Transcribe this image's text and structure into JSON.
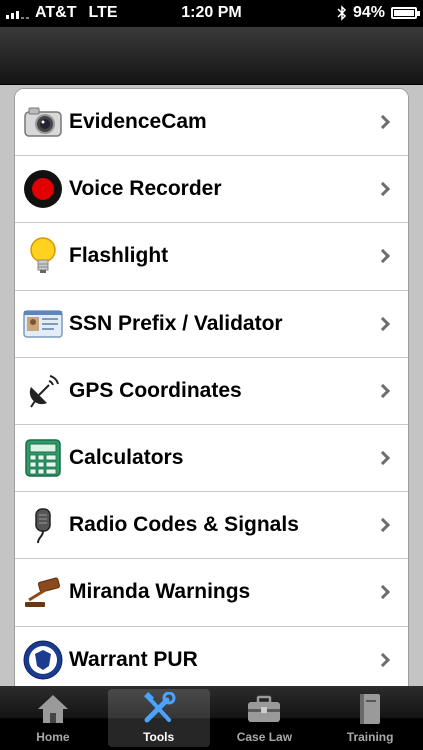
{
  "status_bar": {
    "carrier": "AT&T",
    "network": "LTE",
    "time": "1:20 PM",
    "battery_percent_text": "94%",
    "battery_level": 0.94,
    "bluetooth_icon": "bluetooth-icon"
  },
  "nav_bar": {
    "title": ""
  },
  "tools": {
    "items": [
      {
        "label": "EvidenceCam",
        "icon": "camera-icon"
      },
      {
        "label": "Voice Recorder",
        "icon": "record-icon"
      },
      {
        "label": "Flashlight",
        "icon": "lightbulb-icon"
      },
      {
        "label": "SSN Prefix / Validator",
        "icon": "id-card-icon"
      },
      {
        "label": "GPS Coordinates",
        "icon": "satellite-dish-icon"
      },
      {
        "label": "Calculators",
        "icon": "calculator-icon"
      },
      {
        "label": "Radio Codes & Signals",
        "icon": "radio-mic-icon"
      },
      {
        "label": "Miranda Warnings",
        "icon": "gavel-icon"
      },
      {
        "label": "Warrant PUR",
        "icon": "police-badge-icon"
      }
    ]
  },
  "tab_bar": {
    "selected": "Tools",
    "tabs": [
      {
        "label": "Home",
        "icon": "home-icon"
      },
      {
        "label": "Tools",
        "icon": "tools-icon"
      },
      {
        "label": "Case Law",
        "icon": "briefcase-icon"
      },
      {
        "label": "Training",
        "icon": "book-icon"
      }
    ]
  },
  "colors": {
    "status_bar_bg": "#000000",
    "nav_bar_bg": "#1e1e1e",
    "list_bg": "#ffffff",
    "page_bg": "#c4c4c4",
    "record_red": "#e00000",
    "tab_active_bg": "#3a3a3a"
  }
}
